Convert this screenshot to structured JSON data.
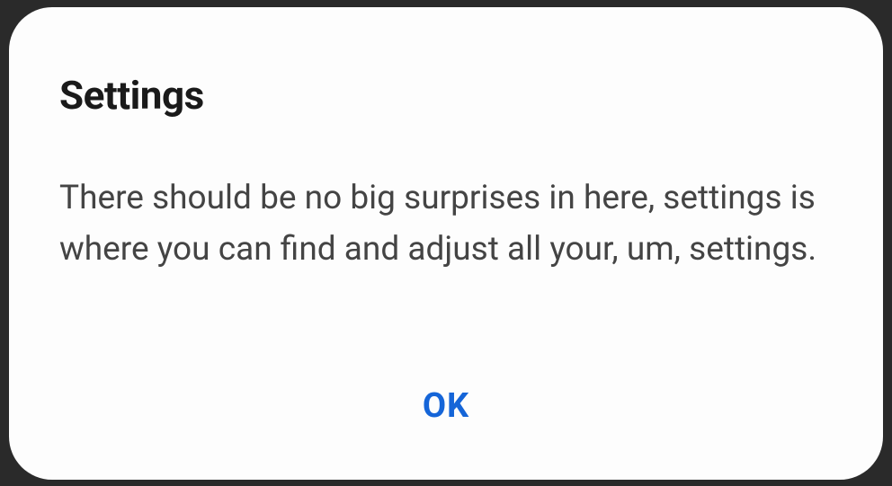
{
  "dialog": {
    "title": "Settings",
    "body": "There should be no big surprises in here, settings is where you can find and adjust all your, um, settings.",
    "ok_label": "OK"
  }
}
